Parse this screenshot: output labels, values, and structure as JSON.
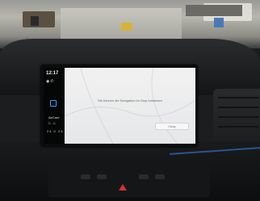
{
  "status_bar": {
    "time": "12:17",
    "icons": [
      "wifi-icon",
      "phone-icon"
    ]
  },
  "sidebar": {
    "home_icon": "square-outline-icon",
    "aircare_label": "AirCare",
    "seat_icons": [
      "seat-heat-left-icon",
      "seat-heat-right-icon"
    ],
    "temps": [
      "24.0",
      "24.0"
    ]
  },
  "dialog": {
    "message": "Sie können die Navigation im Stop fortsetzen",
    "ok_label": "Okay"
  },
  "colors": {
    "accent": "#3ea0ff",
    "hazard": "#d3322c",
    "ambient": "#2f6ec9"
  }
}
